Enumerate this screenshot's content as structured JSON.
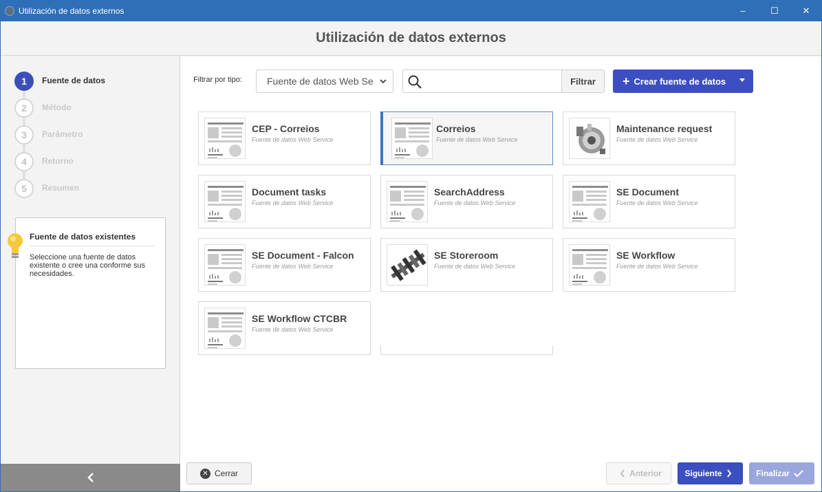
{
  "window": {
    "title": "Utilización de datos externos",
    "controls": [
      "–",
      "☐",
      "✕"
    ]
  },
  "header": {
    "title": "Utilización de datos externos"
  },
  "steps": [
    {
      "num": "1",
      "label": "Fuente de datos",
      "active": true
    },
    {
      "num": "2",
      "label": "Método",
      "active": false
    },
    {
      "num": "3",
      "label": "Parámetro",
      "active": false
    },
    {
      "num": "4",
      "label": "Retorno",
      "active": false
    },
    {
      "num": "5",
      "label": "Resumen",
      "active": false
    }
  ],
  "help": {
    "title": "Fuente de datos existentes",
    "text": "Seleccione una fuente de datos existente o cree una conforme sus necesidades."
  },
  "toolbar": {
    "filter_label": "Filtrar por tipo:",
    "filter_value": "Fuente de datos Web Se",
    "search_value": "",
    "filter_button": "Filtrar",
    "create_button": "Crear fuente de datos"
  },
  "cards": [
    {
      "name": "CEP - Correios",
      "type": "Fuente de datos Web Service",
      "icon": "document-thumbnail",
      "selected": false
    },
    {
      "name": "Correios",
      "type": "Fuente de datos Web Service",
      "icon": "document-thumbnail",
      "selected": true
    },
    {
      "name": "Maintenance request",
      "type": "Fuente de datos Web Service",
      "icon": "alternator-image",
      "selected": false
    },
    {
      "name": "Document tasks",
      "type": "Fuente de datos Web Service",
      "icon": "document-thumbnail",
      "selected": false
    },
    {
      "name": "SearchAddress",
      "type": "Fuente de datos Web Service",
      "icon": "document-thumbnail",
      "selected": false
    },
    {
      "name": "SE Document",
      "type": "Fuente de datos Web Service",
      "icon": "document-thumbnail",
      "selected": false
    },
    {
      "name": "SE Document - Falcon",
      "type": "Fuente de datos Web Service",
      "icon": "document-thumbnail",
      "selected": false
    },
    {
      "name": "SE Storeroom",
      "type": "Fuente de datos Web Service",
      "icon": "crankshaft-image",
      "selected": false
    },
    {
      "name": "SE Workflow",
      "type": "Fuente de datos Web Service",
      "icon": "document-thumbnail",
      "selected": false
    },
    {
      "name": "SE Workflow CTCBR",
      "type": "Fuente de datos Web Service",
      "icon": "document-thumbnail",
      "selected": false
    }
  ],
  "footer": {
    "close": "Cerrar",
    "previous": "Anterior",
    "next": "Siguiente",
    "finish": "Finalizar"
  },
  "colors": {
    "accent": "#3c4fc0",
    "titlebar": "#2f6fb8",
    "selected_border": "#3b76c4"
  }
}
